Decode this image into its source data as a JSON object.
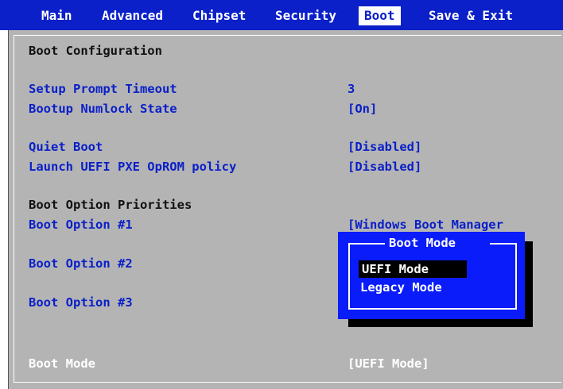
{
  "menu": {
    "tabs": [
      "Main",
      "Advanced",
      "Chipset",
      "Security",
      "Boot",
      "Save & Exit"
    ],
    "active_tab": "Boot"
  },
  "panel": {
    "section_title": "Boot Configuration",
    "items": [
      {
        "label": "Setup Prompt Timeout",
        "value": "3"
      },
      {
        "label": "Bootup Numlock State",
        "value": "[On]"
      },
      {
        "label": "Quiet Boot",
        "value": "[Disabled]"
      },
      {
        "label": "Launch UEFI PXE OpROM policy",
        "value": "[Disabled]"
      }
    ],
    "priorities_title": "Boot Option Priorities",
    "boot_options": [
      {
        "label": "Boot Option #1",
        "value": "[Windows Boot Manager"
      },
      {
        "label": "Boot Option #2"
      },
      {
        "label": "Boot Option #3"
      }
    ],
    "boot_mode": {
      "label": "Boot Mode",
      "value": "[UEFI Mode]"
    }
  },
  "popup": {
    "title": "Boot Mode",
    "options": [
      "UEFI Mode",
      "Legacy Mode"
    ],
    "selected": "UEFI Mode"
  },
  "colors": {
    "accent_blue": "#0b20c8",
    "popup_blue": "#0a1cfa",
    "panel_gray": "#b4b4b4"
  }
}
